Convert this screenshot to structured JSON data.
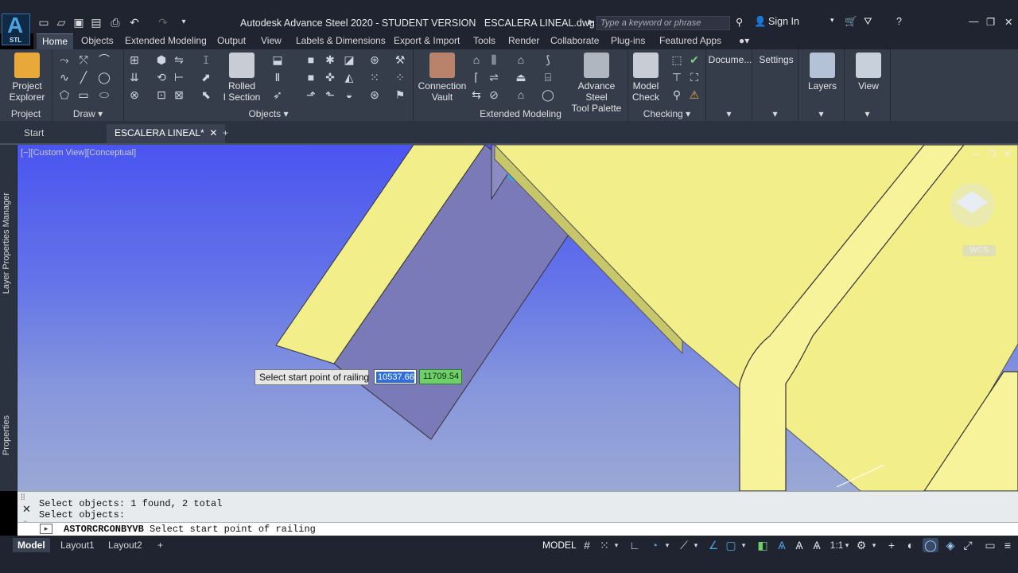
{
  "app": {
    "logo_letter": "A",
    "logo_sub": "STL",
    "title": "Autodesk Advance Steel 2020 - STUDENT VERSION",
    "file": "ESCALERA LINEAL.dwg",
    "search_placeholder": "Type a keyword or phrase",
    "sign_in": "Sign In"
  },
  "tabs": [
    "Home",
    "Objects",
    "Extended Modeling",
    "Output",
    "View",
    "Labels & Dimensions",
    "Export & Import",
    "Tools",
    "Render",
    "Collaborate",
    "Plug-ins",
    "Featured Apps"
  ],
  "ribbon": {
    "project": {
      "btn1": "Project",
      "btn2": "Explorer",
      "label": "Project"
    },
    "draw": {
      "label": "Draw"
    },
    "objects": {
      "rolled1": "Rolled",
      "rolled2": "I Section",
      "label": "Objects"
    },
    "extended": {
      "cv1": "Connection",
      "cv2": "Vault",
      "as1": "Advance Steel",
      "as2": "Tool Palette",
      "label": "Extended Modeling"
    },
    "checking": {
      "mc1": "Model",
      "mc2": "Check",
      "label": "Checking"
    },
    "docs": {
      "label": "Docume..."
    },
    "settings": {
      "label": "Settings"
    },
    "layers": {
      "label": "Layers"
    },
    "view": {
      "label": "View"
    }
  },
  "doc_tabs": {
    "start": "Start",
    "active": "ESCALERA LINEAL*"
  },
  "viewport": {
    "label": "[−][Custom View][Conceptual]",
    "wcs": "WCS",
    "prompt": "Select start point of railing",
    "coord_x": "10537.66",
    "coord_y": "11709.54"
  },
  "left_panels": {
    "layer": "Layer Properties Manager",
    "props": "Properties"
  },
  "command": {
    "line1": "Select objects: 1 found, 2 total",
    "line2": "Select objects:",
    "cmd_name": "ASTORCRCONBYVB",
    "cmd_text": "Select start point of railing"
  },
  "status": {
    "model_tab": "Model",
    "layout1": "Layout1",
    "layout2": "Layout2",
    "model_btn": "MODEL",
    "scale": "1:1"
  },
  "colors": {
    "viewport_top": "#4a55f0",
    "beam_yellow": "#f2ef8a",
    "plate_gray": "#7a7ab8"
  }
}
